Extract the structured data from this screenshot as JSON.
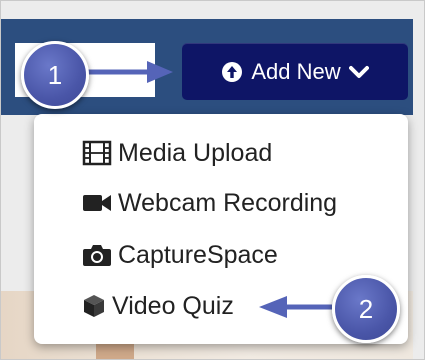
{
  "toolbar": {
    "add_new_label": "Add New"
  },
  "dropdown": {
    "items": [
      {
        "label": "Media Upload",
        "icon": "film-icon"
      },
      {
        "label": "Webcam Recording",
        "icon": "video-camera-icon"
      },
      {
        "label": "CaptureSpace",
        "icon": "camera-icon"
      },
      {
        "label": "Video Quiz",
        "icon": "cube-icon"
      }
    ]
  },
  "annotations": {
    "step1": "1",
    "step2": "2"
  },
  "colors": {
    "header_bg": "#2c4e7f",
    "button_bg": "#0e1566",
    "marker": "#4a56a8",
    "arrow": "#5564b8"
  }
}
